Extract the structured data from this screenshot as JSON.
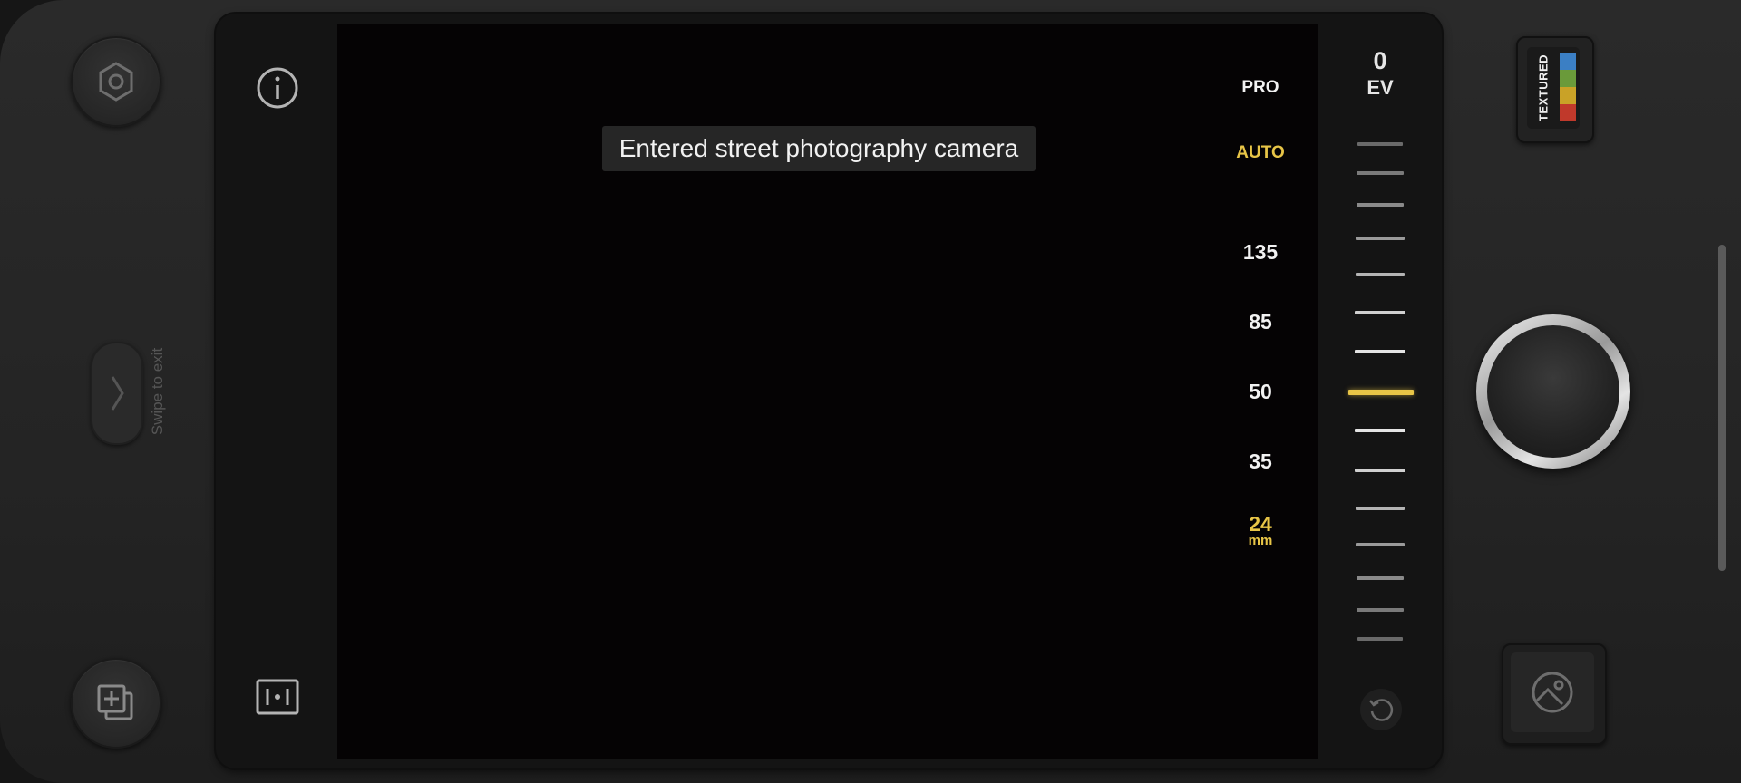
{
  "toast": {
    "text": "Entered street photography camera"
  },
  "mode": {
    "pro_label": "PRO",
    "auto_label": "AUTO"
  },
  "focal_lengths": [
    {
      "label": "135"
    },
    {
      "label": "85"
    },
    {
      "label": "50"
    },
    {
      "label": "35"
    },
    {
      "label": "24",
      "unit": "mm",
      "selected": true
    }
  ],
  "exposure": {
    "value": "0",
    "unit_label": "EV"
  },
  "swipe": {
    "label": "Swipe to exit"
  },
  "film": {
    "label": "TEXTURED",
    "stripe_colors": [
      "#3b7fc4",
      "#6a9a3a",
      "#c9a227",
      "#c0392b"
    ]
  },
  "colors": {
    "accent": "#e8c547",
    "background": "#161616",
    "panel": "#141414",
    "viewfinder": "#050304",
    "text": "#f2f2f2"
  },
  "icons": {
    "settings": "hexagon-settings-icon",
    "info": "info-icon",
    "add_layers": "add-layers-icon",
    "frame": "frame-icon",
    "reset": "reset-icon",
    "gallery": "gallery-icon",
    "chevron": "chevron-right-icon"
  }
}
